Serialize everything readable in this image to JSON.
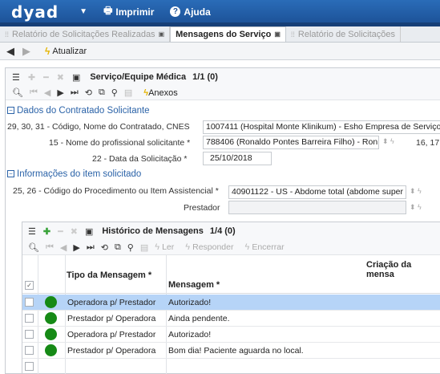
{
  "header": {
    "logo": "dyad",
    "print_label": "Imprimir",
    "help_label": "Ajuda"
  },
  "tabs": [
    {
      "label": "Relatório de Solicitações Realizadas"
    },
    {
      "label": "Mensagens do Serviço"
    },
    {
      "label": "Relatório de Solicitações"
    }
  ],
  "nav": {
    "refresh_label": "Atualizar"
  },
  "panel": {
    "title": "Serviço/Equipe Médica",
    "count": "1/1 (0)",
    "attachments_label": "Anexos"
  },
  "contractor": {
    "section_title": "Dados do Contratado Solicitante",
    "fields": {
      "contractor_label": "29, 30, 31 - Código, Nome do Contratado, CNES",
      "contractor_value": "1007411 (Hospital Monte Klinikum) - Esho Empresa de Serviço",
      "professional_label": "15 - Nome do profissional solicitante *",
      "professional_value": "788406 (Ronaldo Pontes Barreira Filho) - Ron",
      "professional_extra": "16, 17",
      "date_label": "22 - Data da Solicitação *",
      "date_value": "25/10/2018"
    }
  },
  "item": {
    "section_title": "Informações do item solicitado",
    "fields": {
      "procedure_label": "25, 26 - Código do Procedimento ou Item Assistencial *",
      "procedure_value": "40901122 - US - Abdome total (abdome super",
      "provider_label": "Prestador",
      "provider_value": ""
    }
  },
  "history": {
    "title": "Histórico de Mensagens",
    "count": "1/4 (0)",
    "actions": {
      "read": "Ler",
      "reply": "Responder",
      "close": "Encerrar"
    },
    "columns": {
      "type": "Tipo da Mensagem *",
      "message": "Mensagem *",
      "created": "Criação da mensa"
    },
    "rows": [
      {
        "type": "Operadora p/ Prestador",
        "message": "Autorizado!",
        "status_color": "#168a16"
      },
      {
        "type": "Prestador p/ Operadora",
        "message": "Ainda pendente.",
        "status_color": "#168a16"
      },
      {
        "type": "Operadora p/ Prestador",
        "message": "Autorizado!",
        "status_color": "#168a16"
      },
      {
        "type": "Prestador p/ Operadora",
        "message": "Bom dia! Paciente aguarda no local.",
        "status_color": "#168a16"
      }
    ]
  },
  "colors": {
    "header_bg": "#1b4f94",
    "section_title": "#2b63a8",
    "selected_row": "#b6d4f7",
    "status_green": "#168a16"
  }
}
